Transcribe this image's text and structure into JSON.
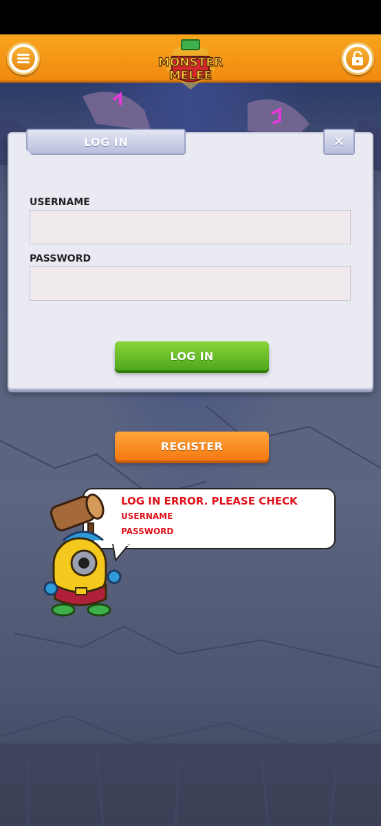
{
  "header": {
    "menu_icon": "hamburger-menu-icon",
    "lock_icon": "unlock-icon",
    "logo_line1": "MONSTER",
    "logo_line2": "MELEE"
  },
  "dialog": {
    "tab_label": "LOG IN",
    "close_label": "✕",
    "username_label": "USERNAME",
    "username_value": "",
    "password_label": "PASSWORD",
    "password_value": "",
    "login_button_label": "LOG IN"
  },
  "register_button_label": "REGISTER",
  "error": {
    "title": "LOG IN ERROR. PLEASE CHECK",
    "items": [
      "USERNAME",
      "PASSWORD"
    ]
  },
  "colors": {
    "header": "#f39518",
    "login_button": "#5cb82a",
    "register_button": "#f7861c",
    "error_text": "#e0111a",
    "dialog_bg": "#e9eaf2"
  }
}
